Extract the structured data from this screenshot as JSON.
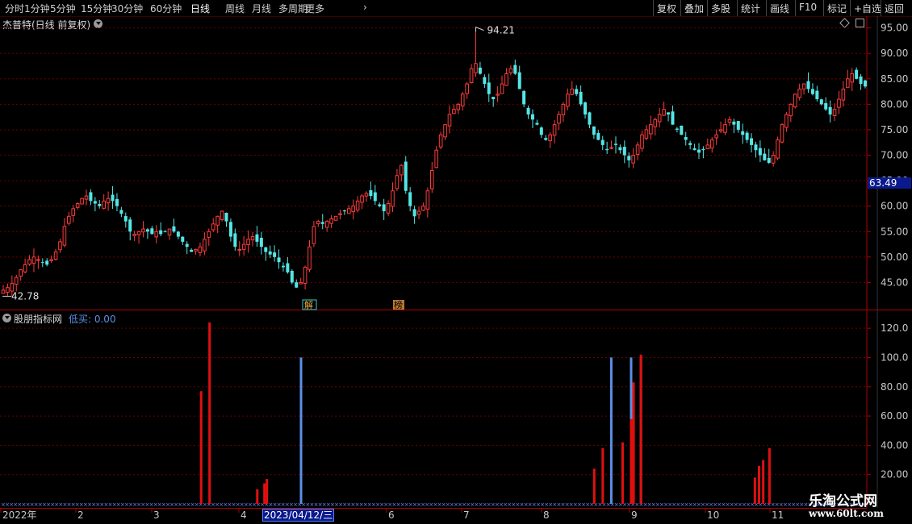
{
  "toolbar": {
    "left_items": [
      "分时",
      "1分钟",
      "5分钟",
      "15分钟",
      "30分钟",
      "60分钟",
      "日线",
      "周线",
      "月线",
      "多周期",
      "更多"
    ],
    "active_index": 6,
    "right_items": [
      "复权",
      "叠加",
      "多股",
      "统计",
      "画线",
      "F10",
      "标记",
      "+自选",
      "返回"
    ]
  },
  "main_chart": {
    "title": "杰普特(日线 前复权)",
    "current_price_label": "63.49",
    "high_label": "94.21",
    "low_label": "42.78",
    "badges": [
      "解",
      "榜"
    ],
    "yaxis_labels": [
      "95.00",
      "90.00",
      "85.00",
      "80.00",
      "75.00",
      "70.00",
      "65.00",
      "60.00",
      "55.00",
      "50.00",
      "45.00"
    ]
  },
  "sub_chart": {
    "title": "股朋指标网",
    "value_label": "低买: 0.00",
    "yaxis_labels": [
      "120.0",
      "100.0",
      "80.00",
      "60.00",
      "40.00",
      "20.00"
    ]
  },
  "date_axis": {
    "labels": [
      "2022年",
      "2",
      "3",
      "4",
      "6",
      "7",
      "8",
      "9",
      "10",
      "11"
    ],
    "cursor_date": "2023/04/12/三"
  },
  "watermark": {
    "line1": "乐淘公式网",
    "line2": "www.60lt.com"
  },
  "colors": {
    "up": "#ff3b3b",
    "down": "#54e6e6",
    "buy_bar": "#5b8fe6",
    "sell_bar": "#e01010",
    "grid": "#6a0000",
    "axis": "#b00000"
  },
  "chart_data": [
    {
      "type": "candlestick",
      "title": "杰普特(日线 前复权)",
      "ylim": [
        40,
        97
      ],
      "x_range_dates": [
        "2022-01",
        "2022-11"
      ],
      "high": 94.21,
      "low": 42.78,
      "last": 63.49,
      "close_series": [
        43.5,
        44.0,
        44.8,
        46.0,
        47.5,
        48.5,
        49.5,
        50.0,
        49.5,
        49.0,
        48.5,
        49.5,
        51.0,
        53.0,
        56.0,
        58.0,
        59.5,
        60.5,
        61.5,
        62.0,
        61.0,
        60.5,
        60.0,
        61.0,
        61.5,
        61.0,
        60.0,
        58.5,
        57.0,
        55.0,
        54.5,
        55.0,
        55.5,
        55.0,
        54.5,
        55.0,
        54.5,
        55.0,
        55.5,
        55.0,
        54.0,
        53.0,
        52.0,
        51.0,
        51.5,
        52.0,
        53.5,
        55.0,
        56.5,
        58.0,
        59.0,
        57.0,
        54.0,
        52.0,
        51.5,
        52.5,
        53.5,
        54.0,
        53.0,
        52.0,
        51.0,
        50.5,
        50.0,
        49.0,
        48.0,
        47.0,
        45.0,
        44.0,
        45.0,
        48.0,
        52.0,
        56.0,
        57.0,
        56.5,
        57.0,
        57.5,
        58.0,
        58.5,
        59.0,
        59.5,
        60.0,
        61.0,
        62.0,
        62.5,
        62.0,
        61.0,
        60.0,
        59.0,
        60.5,
        63.0,
        66.0,
        68.0,
        63.0,
        60.0,
        58.0,
        59.0,
        60.0,
        63.0,
        67.0,
        71.0,
        74.0,
        76.0,
        78.0,
        79.0,
        80.0,
        82.0,
        84.0,
        87.0,
        88.0,
        86.0,
        84.0,
        82.0,
        81.0,
        82.0,
        84.0,
        86.0,
        87.0,
        86.0,
        83.0,
        80.0,
        78.0,
        77.0,
        76.0,
        74.0,
        73.0,
        74.0,
        76.0,
        78.0,
        80.0,
        82.0,
        83.0,
        82.0,
        80.0,
        78.0,
        76.0,
        74.0,
        73.0,
        72.0,
        71.0,
        71.5,
        72.0,
        71.0,
        70.0,
        69.0,
        70.0,
        72.0,
        74.0,
        75.0,
        76.0,
        77.0,
        78.0,
        79.0,
        78.0,
        76.0,
        75.0,
        74.0,
        73.0,
        72.0,
        71.0,
        70.5,
        71.0,
        72.0,
        73.0,
        74.0,
        75.0,
        76.0,
        77.0,
        76.0,
        75.0,
        74.0,
        73.0,
        72.0,
        71.0,
        70.0,
        69.0,
        68.5,
        70.0,
        73.0,
        76.0,
        78.0,
        80.0,
        82.0,
        83.0,
        84.0,
        83.0,
        82.0,
        81.0,
        80.0,
        79.0,
        78.0,
        79.0,
        81.0,
        83.0,
        85.0,
        86.0,
        85.0,
        84.0,
        83.5
      ]
    },
    {
      "type": "bar",
      "title": "股朋指标网",
      "ylim": [
        0,
        130
      ],
      "series": [
        {
          "name": "低买",
          "color": "#5b8fe6",
          "points": [
            {
              "x": "2023-04-12",
              "y": 100
            },
            {
              "x": "2022-08-25",
              "y": 100
            },
            {
              "x": "2022-09-01",
              "y": 100
            },
            {
              "x": "2022-09-05",
              "y": 100
            }
          ]
        },
        {
          "name": "高卖",
          "color": "#e01010",
          "points": [
            {
              "x": "2022-03-18",
              "y": 77
            },
            {
              "x": "2022-03-21",
              "y": 124
            },
            {
              "x": "2022-04-08",
              "y": 10
            },
            {
              "x": "2022-04-11",
              "y": 14
            },
            {
              "x": "2022-04-12",
              "y": 17
            },
            {
              "x": "2022-08-19",
              "y": 24
            },
            {
              "x": "2022-08-22",
              "y": 38
            },
            {
              "x": "2022-08-29",
              "y": 42
            },
            {
              "x": "2022-09-01",
              "y": 58
            },
            {
              "x": "2022-09-02",
              "y": 83
            },
            {
              "x": "2022-09-05",
              "y": 102
            },
            {
              "x": "2022-10-24",
              "y": 18
            },
            {
              "x": "2022-10-26",
              "y": 26
            },
            {
              "x": "2022-10-28",
              "y": 30
            },
            {
              "x": "2022-10-31",
              "y": 38
            }
          ]
        }
      ]
    }
  ]
}
